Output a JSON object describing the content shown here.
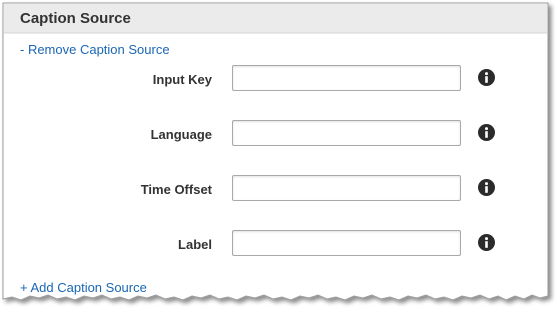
{
  "section": {
    "title": "Caption Source",
    "remove_link": "- Remove Caption Source",
    "add_link": "+ Add Caption Source"
  },
  "fields": [
    {
      "label": "Input Key",
      "value": "",
      "info_icon": "info-icon"
    },
    {
      "label": "Language",
      "value": "",
      "info_icon": "info-icon"
    },
    {
      "label": "Time Offset",
      "value": "",
      "info_icon": "info-icon"
    },
    {
      "label": "Label",
      "value": "",
      "info_icon": "info-icon"
    }
  ],
  "colors": {
    "link": "#1a66b5",
    "header_bg": "#ebebeb",
    "text": "#333333",
    "info_icon": "#2b2b2b"
  }
}
